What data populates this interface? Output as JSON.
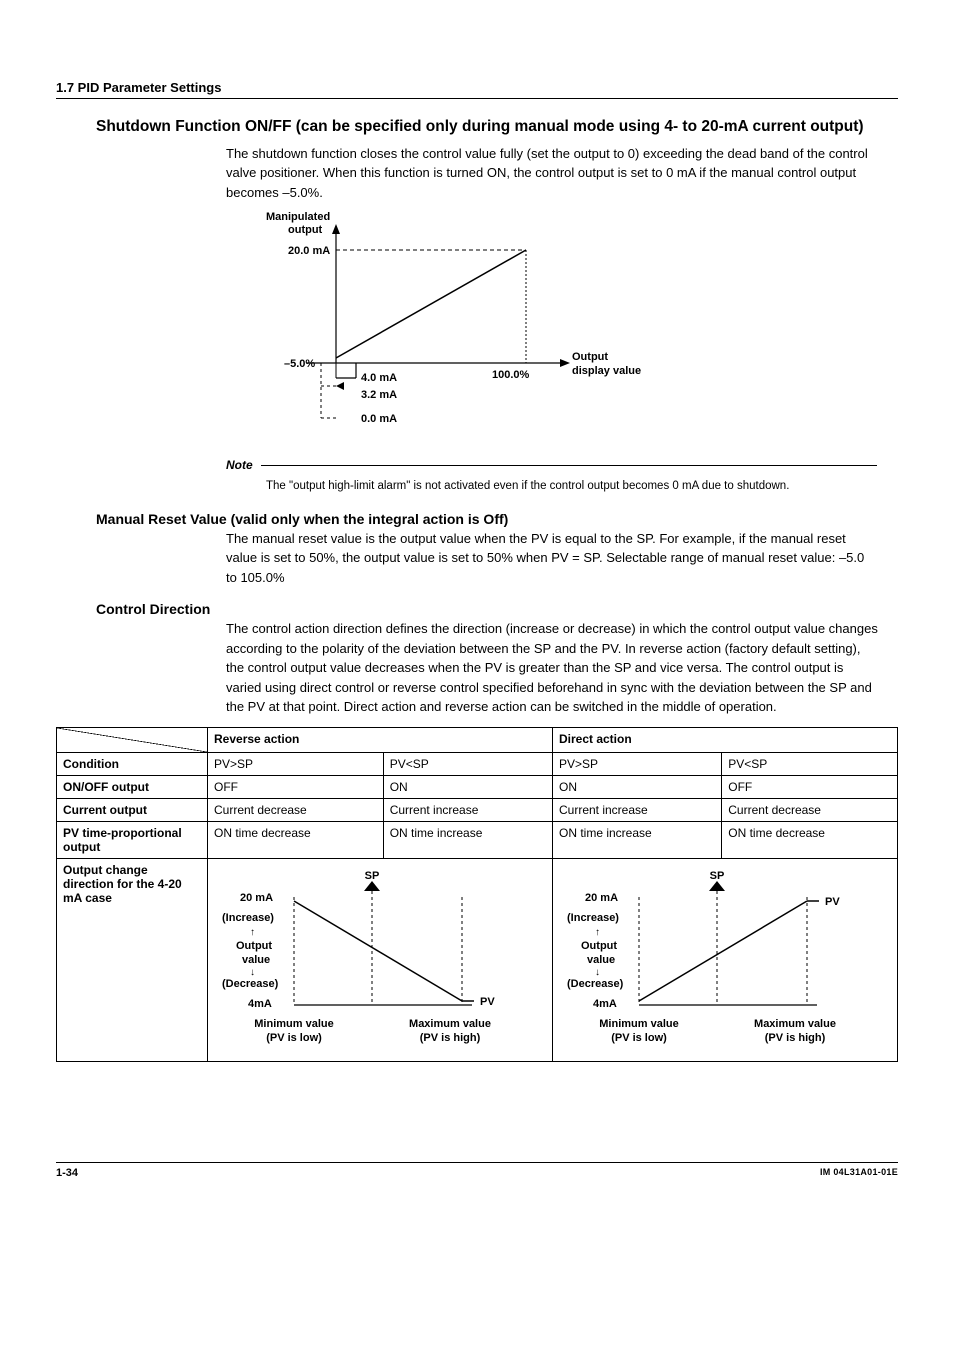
{
  "chart_data": {
    "type": "line",
    "title": "Manipulated output vs Output display value",
    "xlabel": "Output display value",
    "ylabel": "Manipulated output",
    "x": [
      "-5.0%",
      "100.0%"
    ],
    "y_tick_labels": [
      "0.0 mA",
      "3.2 mA",
      "4.0 mA",
      "20.0 mA"
    ],
    "series": [
      {
        "name": "output",
        "points": [
          [
            -5.0,
            3.2
          ],
          [
            100.0,
            20.0
          ]
        ]
      }
    ],
    "annotations": [
      "20.0 mA reached at 100.0%",
      "line crosses y-axis at 4.0 mA (-5.0% → 3.2 mA step shown)"
    ]
  },
  "header": {
    "section": "1.7  PID Parameter Settings"
  },
  "shutdown": {
    "title": "Shutdown Function ON/FF (can be specified only during manual mode using 4- to 20-mA current output)",
    "body": "The shutdown function closes the control value fully (set the output to 0) exceeding the dead band of the control valve positioner.  When this function is turned ON, the control output is set to 0 mA if the manual control output becomes –5.0%.",
    "chart": {
      "y_axis_label1": "Manipulated",
      "y_axis_label2": "output",
      "y_top": "20.0 mA",
      "x_left": "–5.0%",
      "x_right": "100.0%",
      "x_axis_label1": "Output",
      "x_axis_label2": "display value",
      "y_40": "4.0 mA",
      "y_32": "3.2 mA",
      "y_00": "0.0 mA"
    },
    "note_label": "Note",
    "note_text": "The \"output high-limit alarm\" is not activated even if the control output becomes 0 mA due to shutdown."
  },
  "manual_reset": {
    "title": "Manual Reset Value (valid only when the integral action is Off)",
    "body": "The manual reset value is the output value when the PV is equal to the SP.  For example, if the manual reset value is set to 50%, the output value is set to 50% when PV = SP. Selectable range of manual reset value: –5.0 to 105.0%"
  },
  "control_direction": {
    "title": "Control Direction",
    "body": "The control action direction defines the direction (increase or decrease) in which the control output value changes according to the polarity of the deviation between the SP and the PV.  In reverse action (factory default setting), the control output value decreases when the PV is greater than the SP and vice versa.  The control output is varied using direct control or reverse control specified beforehand in sync with the deviation between the SP and the PV at that point.  Direct action and reverse action can be switched in the middle of operation."
  },
  "table": {
    "col_reverse": "Reverse action",
    "col_direct": "Direct action",
    "rows": {
      "condition": {
        "label": "Condition",
        "r1": "PV>SP",
        "r2": "PV<SP",
        "d1": "PV>SP",
        "d2": "PV<SP"
      },
      "onoff": {
        "label": "ON/OFF output",
        "r1": "OFF",
        "r2": "ON",
        "d1": "ON",
        "d2": "OFF"
      },
      "current": {
        "label": "Current output",
        "r1": "Current decrease",
        "r2": "Current increase",
        "d1": "Current increase",
        "d2": "Current decrease"
      },
      "pvtime": {
        "label": "PV time-proportional output",
        "r1": "ON time decrease",
        "r2": "ON time increase",
        "d1": "ON time increase",
        "d2": "ON time decrease"
      },
      "outchange": {
        "label": "Output change direction for the 4-20 mA case"
      }
    },
    "diagram": {
      "v20": "20 mA",
      "inc": "(Increase)",
      "out": "Output",
      "val": "value",
      "dec": "(Decrease)",
      "v4": "4mA",
      "sp": "SP",
      "pv": "PV",
      "min1": "Minimum value",
      "min2": "(PV is low)",
      "max1": "Maximum value",
      "max2": "(PV is high)"
    }
  },
  "footer": {
    "left": "1-34",
    "right": "IM 04L31A01-01E"
  }
}
